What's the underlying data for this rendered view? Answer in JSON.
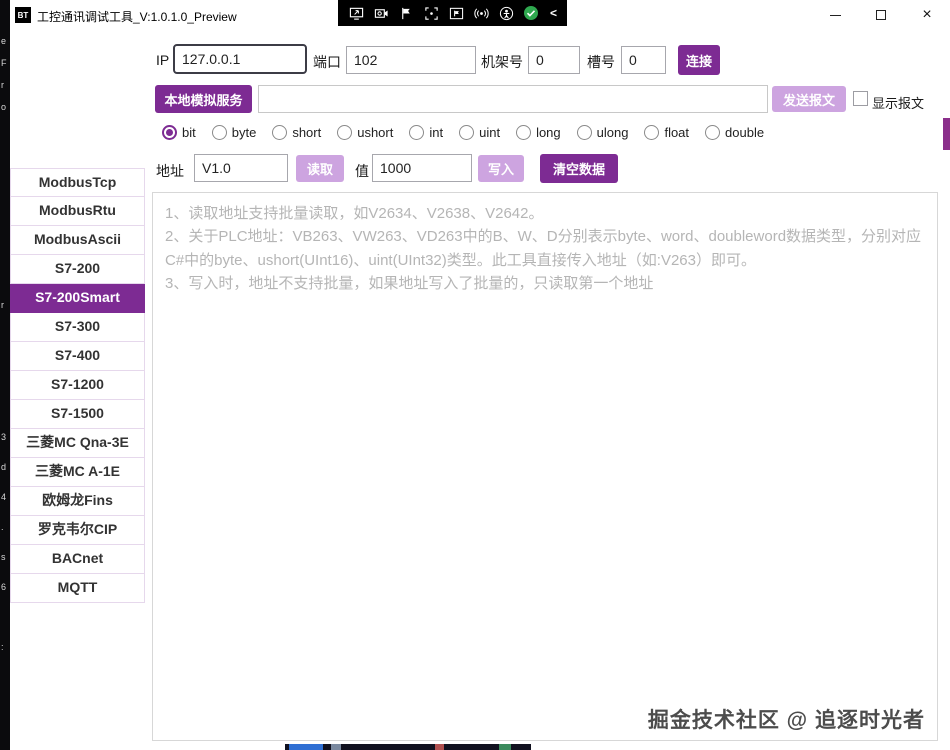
{
  "window": {
    "app_icon_text": "BT",
    "title": "工控通讯调试工具_V:1.0.1.0_Preview",
    "controls": {
      "close_glyph": "×"
    }
  },
  "overlay_toolbar": {
    "icon_names": [
      "screen-share-icon",
      "camera-icon",
      "flag-icon",
      "region-capture-icon",
      "flag-region-icon",
      "broadcast-icon",
      "accessibility-icon",
      "ready-check-icon"
    ],
    "collapse_glyph": "<"
  },
  "sidebar": {
    "items": [
      "ModbusTcp",
      "ModbusRtu",
      "ModbusAscii",
      "S7-200",
      "S7-200Smart",
      "S7-300",
      "S7-400",
      "S7-1200",
      "S7-1500",
      "三菱MC Qna-3E",
      "三菱MC A-1E",
      "欧姆龙Fins",
      "罗克韦尔CIP",
      "BACnet",
      "MQTT"
    ],
    "selected": "S7-200Smart"
  },
  "connection": {
    "ip_label": "IP",
    "ip_value": "127.0.0.1",
    "port_label": "端口",
    "port_value": "102",
    "rack_label": "机架号",
    "rack_value": "0",
    "slot_label": "槽号",
    "slot_value": "0",
    "connect_button": "连接"
  },
  "message_bar": {
    "local_sim_button": "本地模拟服务",
    "message_value": "",
    "send_button": "发送报文",
    "show_message_label": "显示报文",
    "show_message_checked": false
  },
  "datatypes": {
    "options": [
      "bit",
      "byte",
      "short",
      "ushort",
      "int",
      "uint",
      "long",
      "ulong",
      "float",
      "double"
    ],
    "selected": "bit"
  },
  "readwrite": {
    "address_label": "地址",
    "address_value": "V1.0",
    "read_button": "读取",
    "value_label": "值",
    "value_value": "1000",
    "write_button": "写入",
    "clear_button": "清空数据"
  },
  "output": {
    "hint_lines": [
      "1、读取地址支持批量读取，如V2634、V2638、V2642。",
      "2、关于PLC地址：VB263、VW263、VD263中的B、W、D分别表示byte、word、doubleword数据类型，分别对应C#中的byte、ushort(UInt16)、uint(UInt32)类型。此工具直接传入地址（如:V263）即可。",
      "3、写入时，地址不支持批量，如果地址写入了批量的，只读取第一个地址"
    ],
    "watermark": "掘金技术社区 @ 追逐时光者"
  },
  "desktop_edge": {
    "fragments": [
      "e",
      "F",
      "r",
      "o",
      "r",
      "3",
      "d",
      "4",
      ".",
      "s",
      "6",
      ":"
    ]
  },
  "colors": {
    "primary_purple": "#7D2B93",
    "light_purple": "#CDA4E0",
    "hint_gray": "#B5B5B5",
    "ready_green": "#2FA84F"
  }
}
